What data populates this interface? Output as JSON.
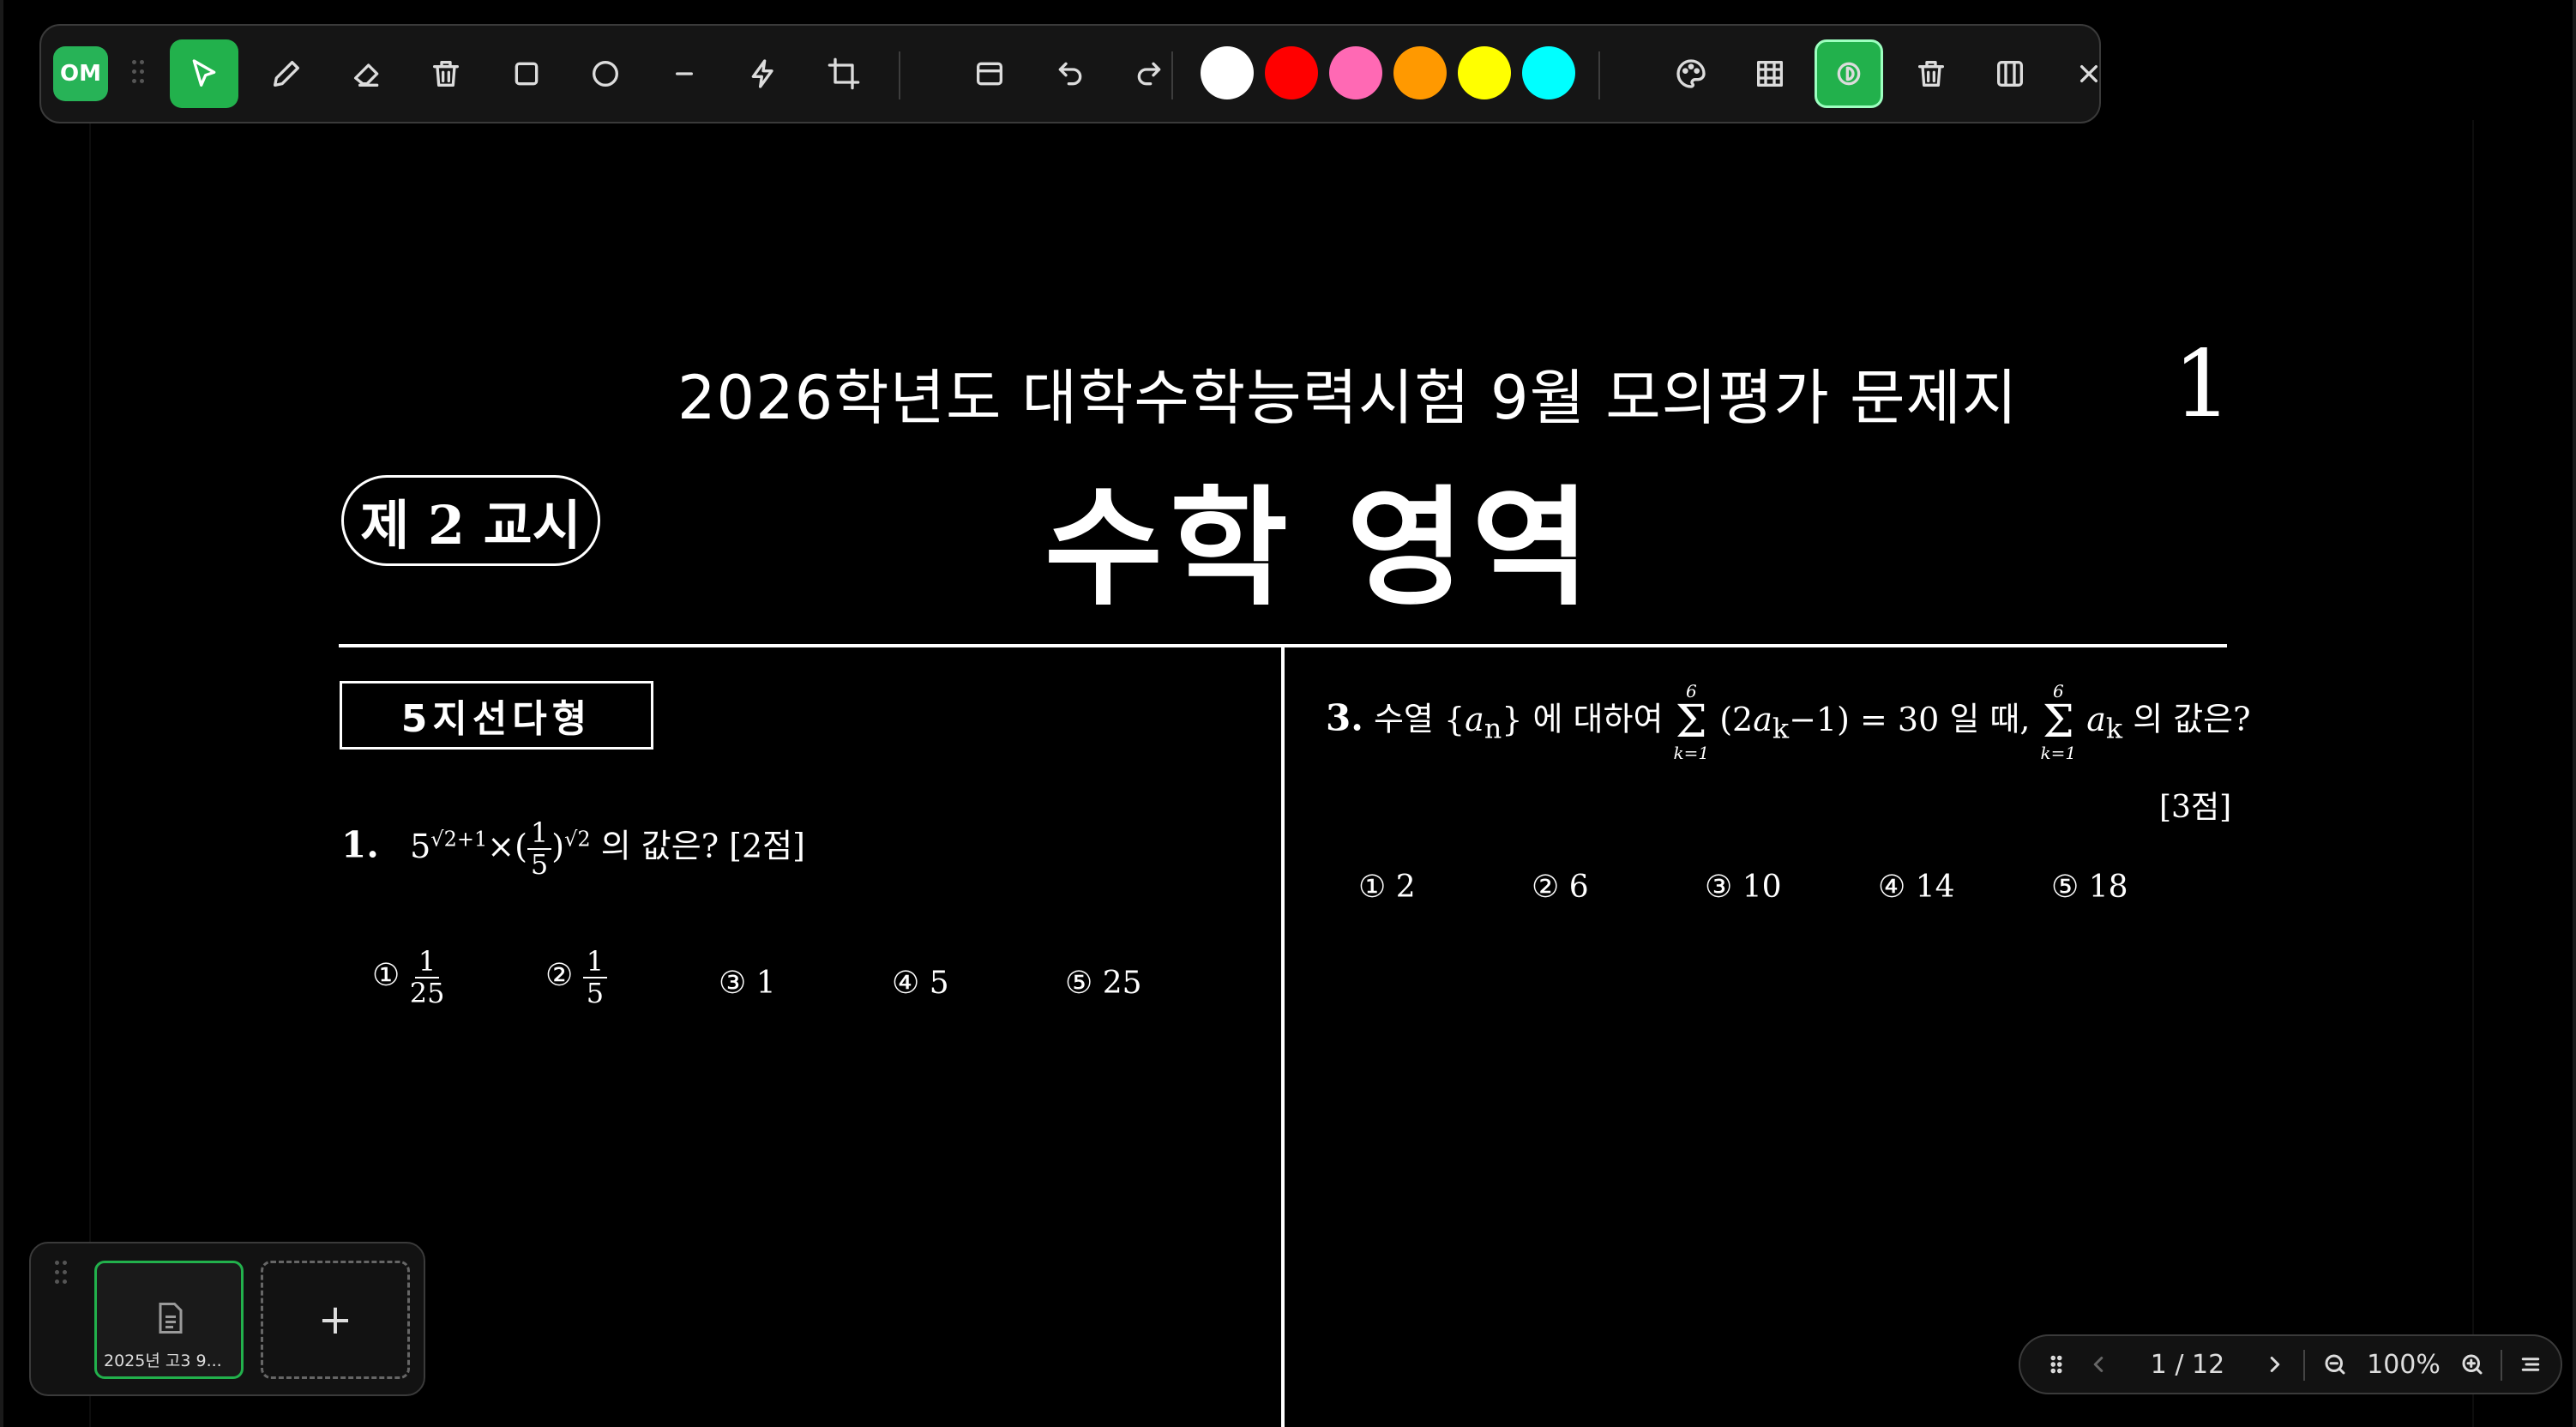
{
  "toolbar": {
    "logo_text": "OM",
    "tools": [
      "select-tool",
      "pen-tool",
      "eraser-tool",
      "delete-tool",
      "rectangle-tool",
      "circle-tool",
      "line-tool",
      "laser-tool",
      "crop-tool",
      "panel-tool",
      "undo",
      "redo"
    ],
    "colors": [
      "#ffffff",
      "#ff0000",
      "#ff69b4",
      "#ff9900",
      "#ffff00",
      "#00ffff"
    ],
    "right_tools": [
      "palette",
      "grid",
      "mode-toggle",
      "trash",
      "columns",
      "close"
    ],
    "accent": "#22b14c"
  },
  "document": {
    "title": "2026학년도 대학수학능력시험 9월 모의평가 문제지",
    "page_number": "1",
    "period": "제 2 교시",
    "subject": "수학 영역",
    "section": "5지선다형",
    "q1": {
      "number": "1.",
      "text_after": "의 값은? [2점]",
      "choices": [
        {
          "mark": "①",
          "num": "1",
          "den": "25"
        },
        {
          "mark": "②",
          "num": "1",
          "den": "5"
        },
        {
          "mark": "③",
          "value": "1"
        },
        {
          "mark": "④",
          "value": "5"
        },
        {
          "mark": "⑤",
          "value": "25"
        }
      ]
    },
    "q3": {
      "number": "3.",
      "text_a": "수열",
      "text_b": "에 대하여",
      "text_c": "일 때,",
      "text_d": "의 값은?",
      "points": "[3점]",
      "choices": [
        {
          "mark": "①",
          "value": "2"
        },
        {
          "mark": "②",
          "value": "6"
        },
        {
          "mark": "③",
          "value": "10"
        },
        {
          "mark": "④",
          "value": "14"
        },
        {
          "mark": "⑤",
          "value": "18"
        }
      ]
    }
  },
  "tray": {
    "thumb_label": "2025년 고3 9...",
    "add_label": "+"
  },
  "pager": {
    "page_indicator": "1 / 12",
    "zoom": "100%"
  }
}
